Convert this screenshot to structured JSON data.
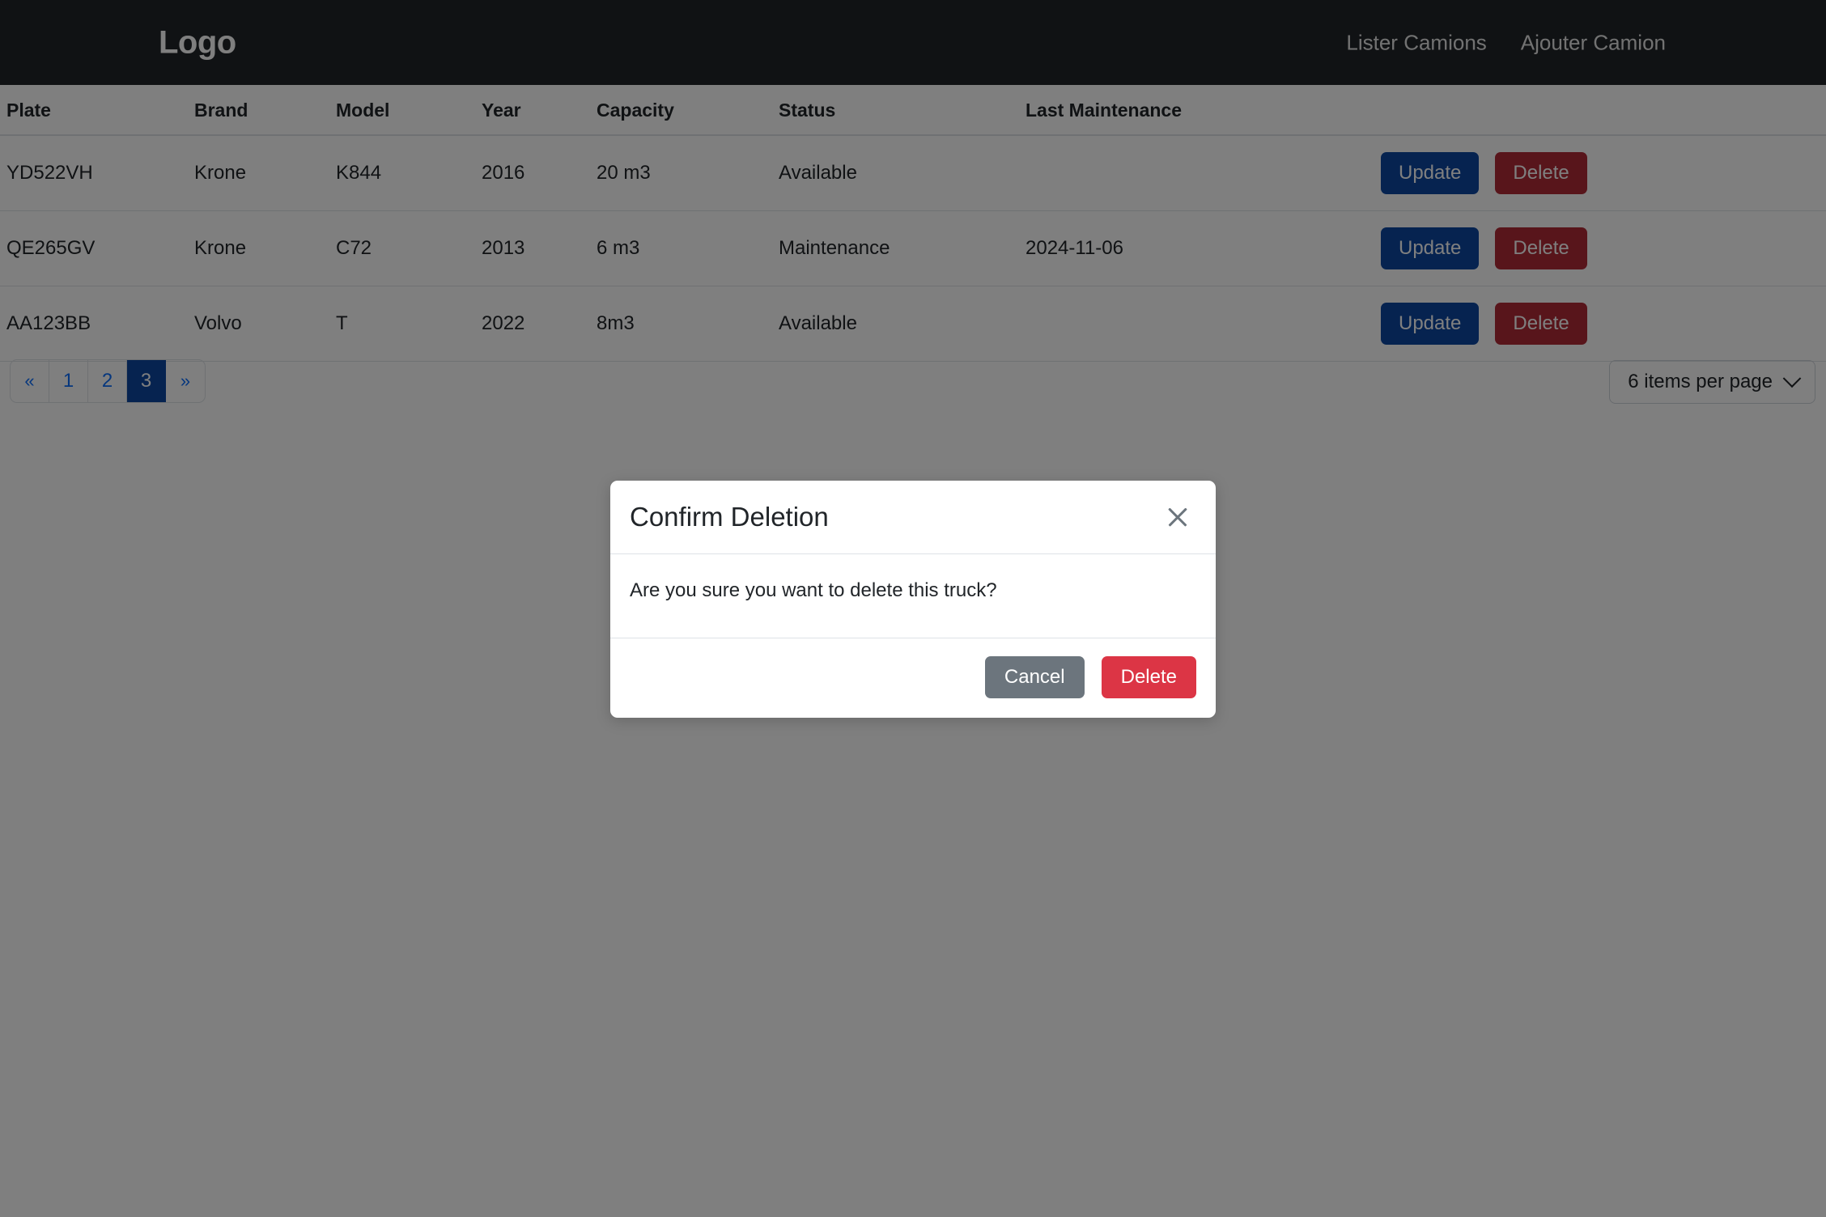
{
  "navbar": {
    "brand": "Logo",
    "links": [
      {
        "label": "Lister Camions"
      },
      {
        "label": "Ajouter Camion"
      }
    ]
  },
  "table": {
    "headers": [
      "Plate",
      "Brand",
      "Model",
      "Year",
      "Capacity",
      "Status",
      "Last Maintenance"
    ],
    "rows": [
      {
        "plate": "YD522VH",
        "brand": "Krone",
        "model": "K844",
        "year": "2016",
        "capacity": "20 m3",
        "status": "Available",
        "last_maintenance": "",
        "update_label": "Update",
        "delete_label": "Delete"
      },
      {
        "plate": "QE265GV",
        "brand": "Krone",
        "model": "C72",
        "year": "2013",
        "capacity": "6 m3",
        "status": "Maintenance",
        "last_maintenance": "2024-11-06",
        "update_label": "Update",
        "delete_label": "Delete"
      },
      {
        "plate": "AA123BB",
        "brand": "Volvo",
        "model": "T",
        "year": "2022",
        "capacity": "8m3",
        "status": "Available",
        "last_maintenance": "",
        "update_label": "Update",
        "delete_label": "Delete"
      }
    ]
  },
  "pagination": {
    "prev_label": "«",
    "next_label": "»",
    "pages": [
      "1",
      "2",
      "3"
    ],
    "active_page": "3"
  },
  "per_page": {
    "selected_label": "6 items per page",
    "icon": "chevron-down-icon"
  },
  "modal": {
    "title": "Confirm Deletion",
    "close_icon": "close-icon",
    "body_text": "Are you sure you want to delete this truck?",
    "cancel_label": "Cancel",
    "delete_label": "Delete"
  },
  "colors": {
    "navbar_bg": "#212529",
    "update_button": "#0d47a1",
    "delete_button_row": "#b02a37",
    "modal_delete_button": "#dc3545",
    "cancel_button": "#6c757d",
    "active_page": "#0d47a1",
    "link_blue": "#0d6efd"
  }
}
